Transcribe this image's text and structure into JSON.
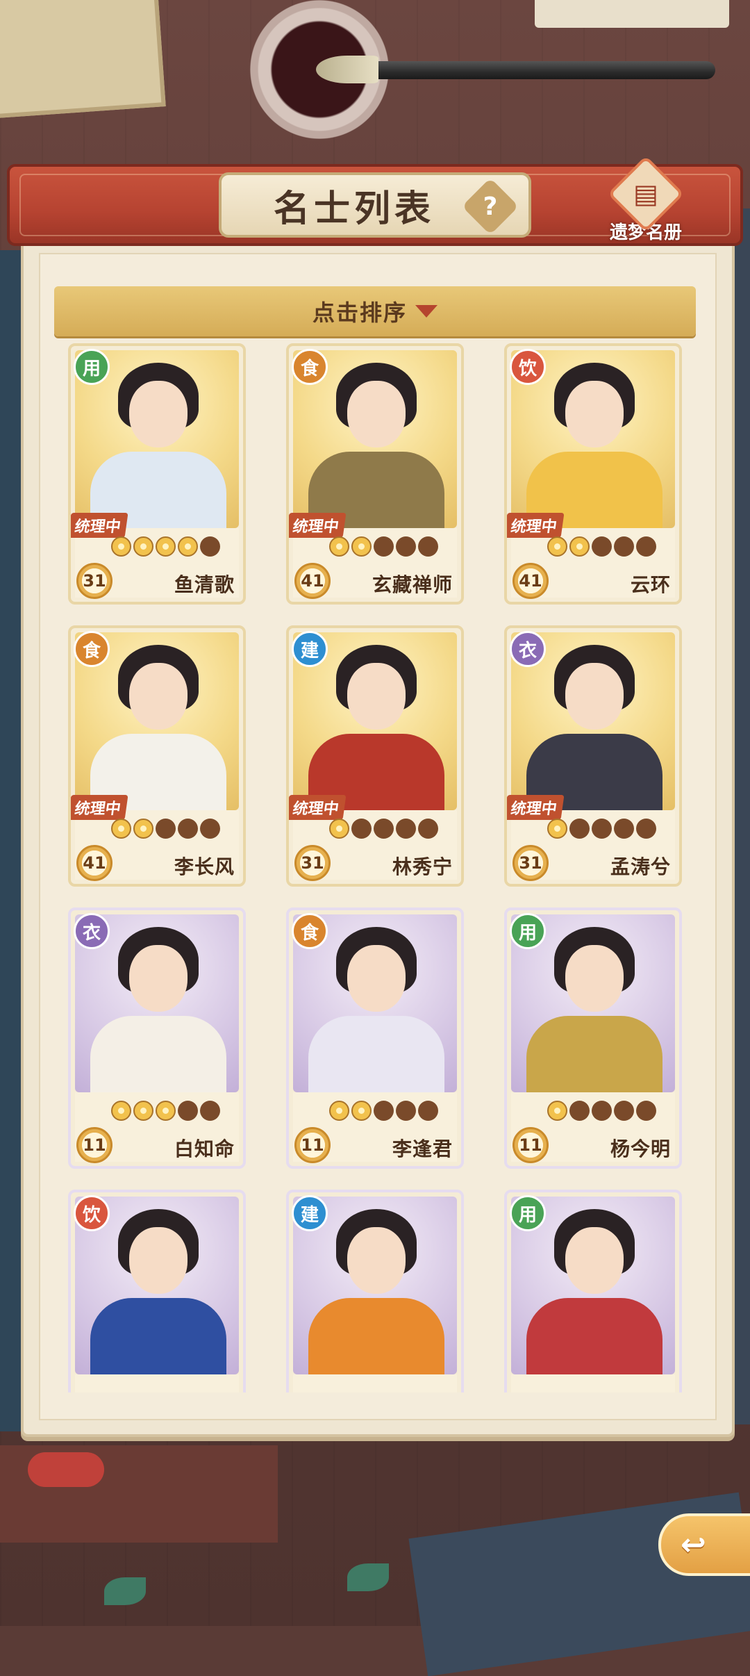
{
  "header": {
    "title": "名士列表",
    "help_glyph": "?",
    "register_label": "遗梦名册",
    "register_icon": "book-icon"
  },
  "sort": {
    "label": "点击排序"
  },
  "colors": {
    "用": "#49a356",
    "食": "#d9852e",
    "饮": "#d9563e",
    "建": "#2e8fd1",
    "衣": "#8a6bb5"
  },
  "cards": [
    {
      "category": "用",
      "name": "鱼清歌",
      "level": "31",
      "stars_on": 4,
      "status": "统理中",
      "rarity": "gold",
      "palette": "#dfe8f2"
    },
    {
      "category": "食",
      "name": "玄藏禅师",
      "level": "41",
      "stars_on": 2,
      "status": "统理中",
      "rarity": "gold",
      "palette": "#8f7a4a"
    },
    {
      "category": "饮",
      "name": "云环",
      "level": "41",
      "stars_on": 2,
      "status": "统理中",
      "rarity": "gold",
      "palette": "#f1c24a"
    },
    {
      "category": "食",
      "name": "李长风",
      "level": "41",
      "stars_on": 2,
      "status": "统理中",
      "rarity": "gold",
      "palette": "#f3f1ea"
    },
    {
      "category": "建",
      "name": "林秀宁",
      "level": "31",
      "stars_on": 1,
      "status": "统理中",
      "rarity": "gold",
      "palette": "#b9382b"
    },
    {
      "category": "衣",
      "name": "孟涛兮",
      "level": "31",
      "stars_on": 1,
      "status": "统理中",
      "rarity": "gold",
      "palette": "#3b3b48"
    },
    {
      "category": "衣",
      "name": "白知命",
      "level": "11",
      "stars_on": 3,
      "status": "",
      "rarity": "purple",
      "palette": "#f4efe6"
    },
    {
      "category": "食",
      "name": "李逢君",
      "level": "11",
      "stars_on": 2,
      "status": "",
      "rarity": "purple",
      "palette": "#e9e6f2"
    },
    {
      "category": "用",
      "name": "杨今明",
      "level": "11",
      "stars_on": 1,
      "status": "",
      "rarity": "purple",
      "palette": "#c9a64a"
    },
    {
      "category": "饮",
      "name": "",
      "level": "",
      "stars_on": 0,
      "status": "",
      "rarity": "purple",
      "palette": "#2f4fa1"
    },
    {
      "category": "建",
      "name": "",
      "level": "",
      "stars_on": 0,
      "status": "",
      "rarity": "purple",
      "palette": "#e88a2e"
    },
    {
      "category": "用",
      "name": "",
      "level": "",
      "stars_on": 0,
      "status": "",
      "rarity": "purple",
      "palette": "#c13a3d"
    }
  ],
  "back_icon": "back-arrow-icon"
}
